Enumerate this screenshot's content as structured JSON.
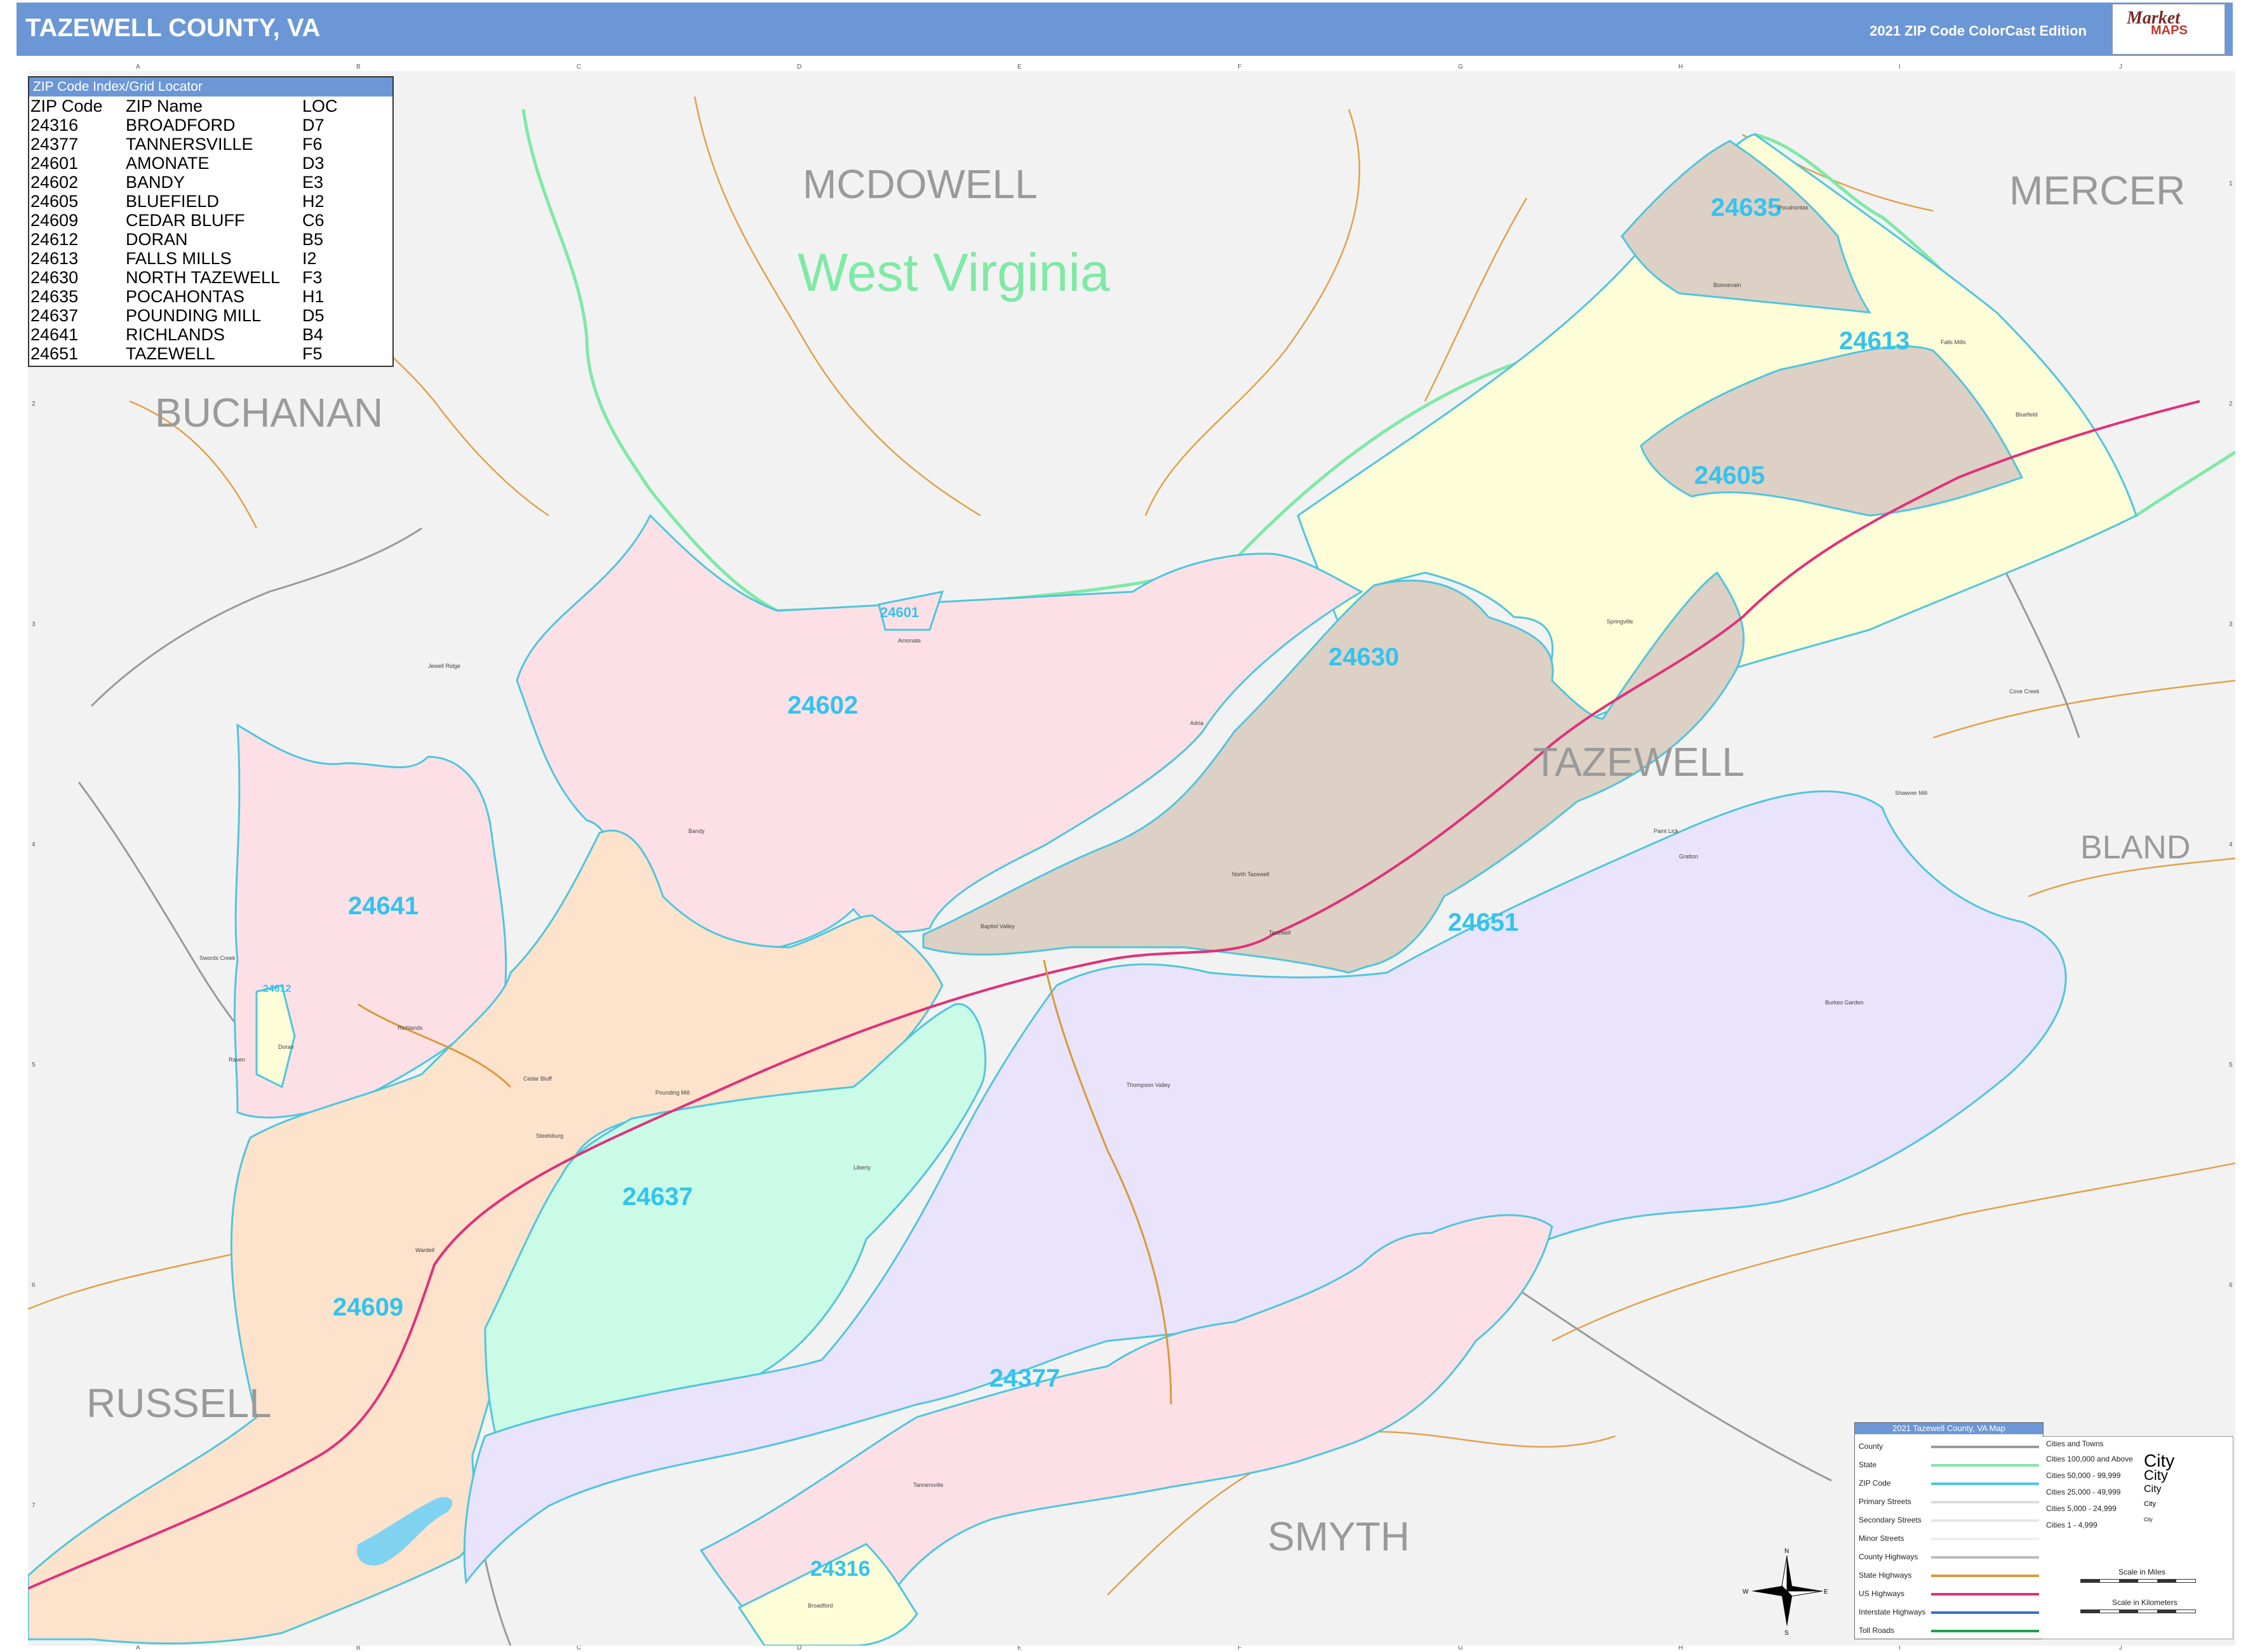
{
  "header": {
    "title": "TAZEWELL COUNTY, VA",
    "edition": "2021 ZIP Code ColorCast Edition",
    "logo_brand": "Market",
    "logo_maps": "MAPS"
  },
  "colors": {
    "header_bg": "#6b97d6",
    "background": "#f2f2f2",
    "zip_label": "#33c3ee",
    "county_label": "#9a9a9a",
    "state_label": "#7fe9a6",
    "zip_boundary": "#4fc6dc",
    "state_line": "#7fe9a6",
    "us_highway": "#e0317a",
    "state_road": "#d99a3a",
    "zip_fills": {
      "24635": "#ddd0c4",
      "24613": "#ddd0c4",
      "24605": "#fdfdd8",
      "24630": "#ddd0c4",
      "24602": "#fce0e6",
      "24601": "#fce0e6",
      "24641": "#fce0e6",
      "24612": "#fdfdd8",
      "24609": "#fde2cc",
      "24637": "#c9fbe7",
      "24651": "#e9e3fb",
      "24377": "#fce0e6",
      "24316": "#fdfdd8"
    }
  },
  "map": {
    "state_label": "West Virginia",
    "county_labels": [
      "MCDOWELL",
      "MERCER",
      "BUCHANAN",
      "TAZEWELL",
      "BLAND",
      "RUSSELL",
      "SMYTH"
    ],
    "zip_labels": [
      "24635",
      "24613",
      "24605",
      "24630",
      "24601",
      "24602",
      "24641",
      "24612",
      "24651",
      "24637",
      "24609",
      "24377",
      "24316"
    ],
    "grid_columns": [
      "A",
      "B",
      "C",
      "D",
      "E",
      "F",
      "G",
      "H",
      "I",
      "J"
    ],
    "grid_rows": [
      "1",
      "2",
      "3",
      "4",
      "5",
      "6",
      "7"
    ],
    "place_labels": [
      "Pocahontas",
      "Bluefield",
      "Falls Mills",
      "Bandy",
      "Amonate",
      "Tannersville",
      "Tazewell",
      "Richlands",
      "Doran",
      "Cedar Bluff",
      "Pounding Mill",
      "Broadford",
      "North Tazewell",
      "Raven",
      "Jewell Ridge",
      "Boissevain",
      "Springville",
      "Gratton",
      "Burkes Garden",
      "Thompson Valley",
      "Liberty",
      "Adria",
      "Baptist Valley",
      "Cove Creek",
      "Shawver Mill",
      "Steelsburg",
      "Paint Lick",
      "Wardell",
      "Swords Creek"
    ]
  },
  "zip_index": {
    "header": "ZIP Code Index/Grid Locator",
    "columns": [
      "ZIP Code",
      "ZIP Name",
      "LOC"
    ],
    "rows": [
      [
        "24316",
        "BROADFORD",
        "D7"
      ],
      [
        "24377",
        "TANNERSVILLE",
        "F6"
      ],
      [
        "24601",
        "AMONATE",
        "D3"
      ],
      [
        "24602",
        "BANDY",
        "E3"
      ],
      [
        "24605",
        "BLUEFIELD",
        "H2"
      ],
      [
        "24609",
        "CEDAR BLUFF",
        "C6"
      ],
      [
        "24612",
        "DORAN",
        "B5"
      ],
      [
        "24613",
        "FALLS MILLS",
        "I2"
      ],
      [
        "24630",
        "NORTH TAZEWELL",
        "F3"
      ],
      [
        "24635",
        "POCAHONTAS",
        "H1"
      ],
      [
        "24637",
        "POUNDING MILL",
        "D5"
      ],
      [
        "24641",
        "RICHLANDS",
        "B4"
      ],
      [
        "24651",
        "TAZEWELL",
        "F5"
      ]
    ]
  },
  "legend": {
    "title": "2021 Tazewell County, VA Map",
    "items": [
      "County",
      "State",
      "ZIP Code",
      "Primary Streets",
      "Secondary Streets",
      "Minor Streets",
      "County Highways",
      "State Highways",
      "US Highways",
      "Interstate Highways",
      "Toll Roads"
    ],
    "cities_heading": "Cities and Towns",
    "city_classes": [
      {
        "label": "Cities 100,000 and Above",
        "sample": "City"
      },
      {
        "label": "Cities 50,000 - 99,999",
        "sample": "City"
      },
      {
        "label": "Cities 25,000 - 49,999",
        "sample": "City"
      },
      {
        "label": "Cities 5,000 - 24,999",
        "sample": "City"
      },
      {
        "label": "Cities 1 - 4,999",
        "sample": "City"
      }
    ],
    "scale_miles": "Scale in Miles",
    "scale_km": "Scale in Kilometers"
  },
  "compass": {
    "n": "N",
    "s": "S",
    "e": "E",
    "w": "W"
  }
}
